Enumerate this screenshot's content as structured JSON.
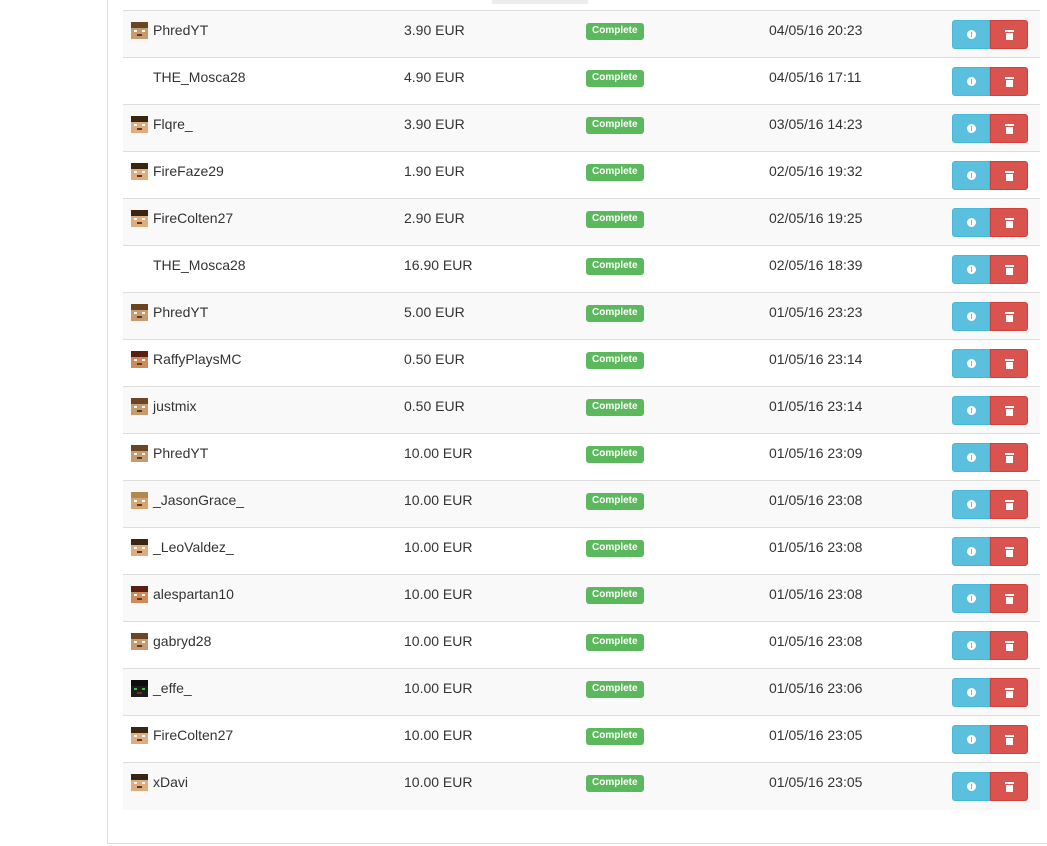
{
  "payments": [
    {
      "username": "PhredYT",
      "amount": "3.90 EUR",
      "status": "Complete",
      "date": "04/05/16 20:23",
      "avatar": "skin-brown-hair"
    },
    {
      "username": "THE_Mosca28",
      "amount": "4.90 EUR",
      "status": "Complete",
      "date": "04/05/16 17:11",
      "avatar": "none"
    },
    {
      "username": "Flqre_",
      "amount": "3.90 EUR",
      "status": "Complete",
      "date": "03/05/16 14:23",
      "avatar": "skin-dark-hair"
    },
    {
      "username": "FireFaze29",
      "amount": "1.90 EUR",
      "status": "Complete",
      "date": "02/05/16 19:32",
      "avatar": "skin-dark-hair"
    },
    {
      "username": "FireColten27",
      "amount": "2.90 EUR",
      "status": "Complete",
      "date": "02/05/16 19:25",
      "avatar": "skin-dark-hair"
    },
    {
      "username": "THE_Mosca28",
      "amount": "16.90 EUR",
      "status": "Complete",
      "date": "02/05/16 18:39",
      "avatar": "none"
    },
    {
      "username": "PhredYT",
      "amount": "5.00 EUR",
      "status": "Complete",
      "date": "01/05/16 23:23",
      "avatar": "skin-brown-hair"
    },
    {
      "username": "RaffyPlaysMC",
      "amount": "0.50 EUR",
      "status": "Complete",
      "date": "01/05/16 23:14",
      "avatar": "skin-red-dark"
    },
    {
      "username": "justmix",
      "amount": "0.50 EUR",
      "status": "Complete",
      "date": "01/05/16 23:14",
      "avatar": "skin-brown-hair"
    },
    {
      "username": "PhredYT",
      "amount": "10.00 EUR",
      "status": "Complete",
      "date": "01/05/16 23:09",
      "avatar": "skin-brown-hair"
    },
    {
      "username": "_JasonGrace_",
      "amount": "10.00 EUR",
      "status": "Complete",
      "date": "01/05/16 23:08",
      "avatar": "skin-blond"
    },
    {
      "username": "_LeoValdez_",
      "amount": "10.00 EUR",
      "status": "Complete",
      "date": "01/05/16 23:08",
      "avatar": "skin-dark-hair"
    },
    {
      "username": "alespartan10",
      "amount": "10.00 EUR",
      "status": "Complete",
      "date": "01/05/16 23:08",
      "avatar": "skin-red-dark"
    },
    {
      "username": "gabryd28",
      "amount": "10.00 EUR",
      "status": "Complete",
      "date": "01/05/16 23:08",
      "avatar": "skin-brown-hair"
    },
    {
      "username": "_effe_",
      "amount": "10.00 EUR",
      "status": "Complete",
      "date": "01/05/16 23:06",
      "avatar": "skin-black-green"
    },
    {
      "username": "FireColten27",
      "amount": "10.00 EUR",
      "status": "Complete",
      "date": "01/05/16 23:05",
      "avatar": "skin-dark-hair"
    },
    {
      "username": "xDavi",
      "amount": "10.00 EUR",
      "status": "Complete",
      "date": "01/05/16 23:05",
      "avatar": "skin-dark-hair"
    }
  ],
  "colors": {
    "complete_badge": "#5cb85c",
    "info_button": "#5bc0de",
    "delete_button": "#d9534f",
    "row_stripe": "#f9f9f9",
    "row_border": "#dddddd",
    "text": "#333333"
  },
  "icons": {
    "info": "info-circle-icon",
    "delete": "trash-icon"
  }
}
